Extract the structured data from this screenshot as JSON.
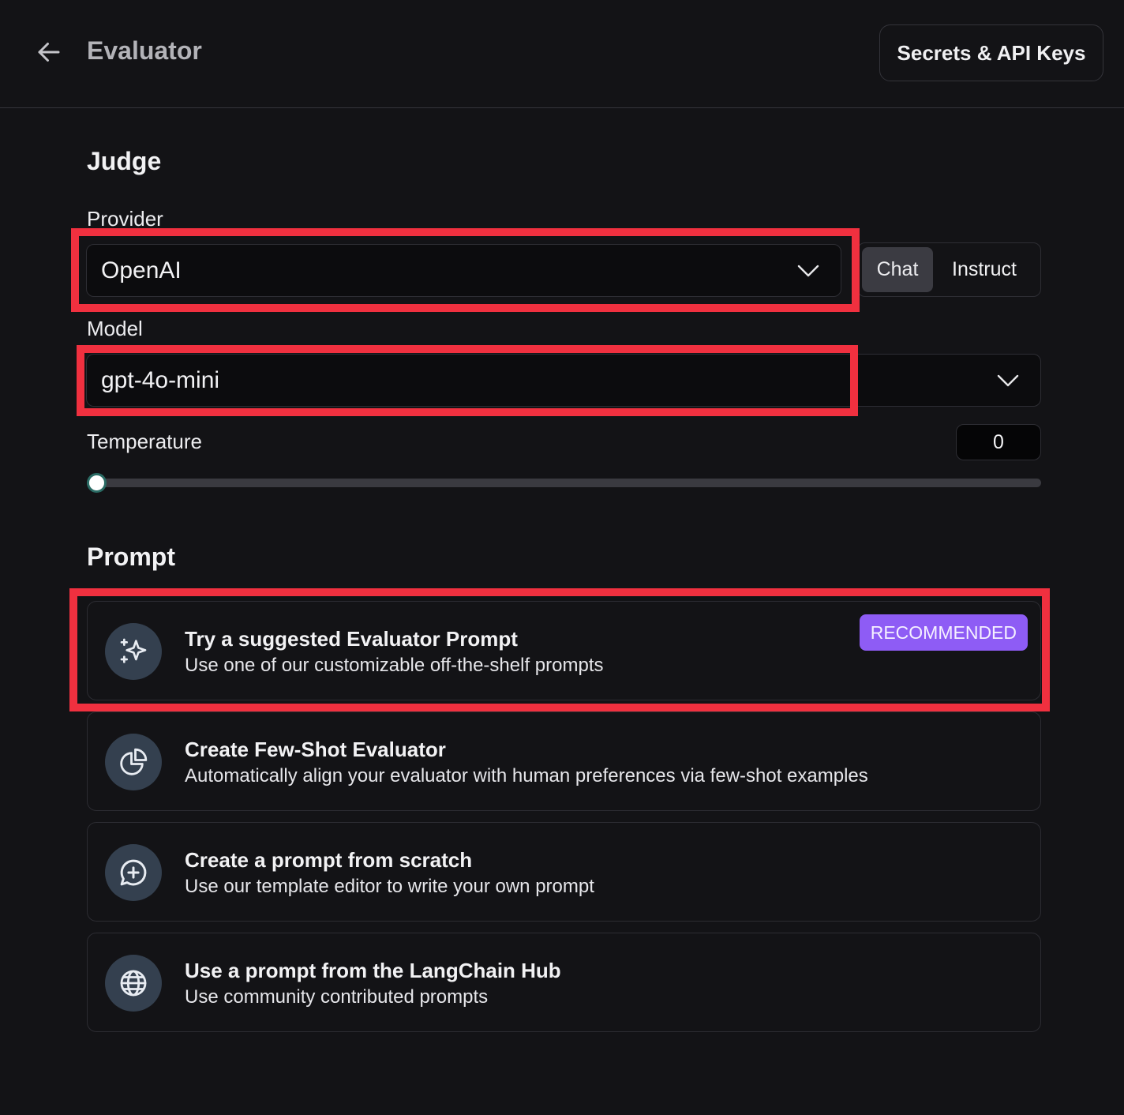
{
  "header": {
    "title": "Evaluator",
    "secrets_button": "Secrets & API Keys"
  },
  "judge": {
    "title": "Judge",
    "provider": {
      "label": "Provider",
      "value": "OpenAI",
      "modes": [
        {
          "label": "Chat",
          "active": true
        },
        {
          "label": "Instruct",
          "active": false
        }
      ]
    },
    "model": {
      "label": "Model",
      "value": "gpt-4o-mini"
    },
    "temperature": {
      "label": "Temperature",
      "value": "0",
      "slider_fraction": 0
    }
  },
  "prompt": {
    "title": "Prompt",
    "options": [
      {
        "title": "Try a suggested Evaluator Prompt",
        "description": "Use one of our customizable off-the-shelf prompts",
        "badge": "RECOMMENDED",
        "icon": "sparkles-icon"
      },
      {
        "title": "Create Few-Shot Evaluator",
        "description": "Automatically align your evaluator with human preferences via few-shot examples",
        "icon": "pie-chart-icon"
      },
      {
        "title": "Create a prompt from scratch",
        "description": "Use our template editor to write your own prompt",
        "icon": "message-plus-icon"
      },
      {
        "title": "Use a prompt from the LangChain Hub",
        "description": "Use community contributed prompts",
        "icon": "globe-icon"
      }
    ]
  },
  "colors": {
    "background": "#131316",
    "highlight": "#f0303f",
    "badge": "#8e5cf5",
    "icon_circle": "#34404f"
  }
}
